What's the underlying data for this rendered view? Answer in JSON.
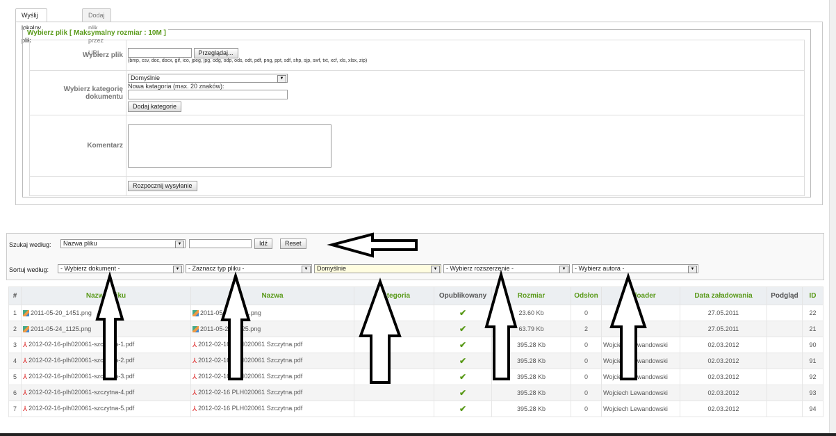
{
  "tabs": [
    "Wyślij lokalny plik",
    "Dodaj plik przez URL"
  ],
  "upload": {
    "legend": "Wybierz plik [ Maksymalny rozmiar : 10M ]",
    "file_label": "Wybierz plik",
    "browse": "Przeglądaj...",
    "extensions": "(bmp, csv, doc, docx, gif, ico, jpeg, jpg, odg, odp, ods, odt, pdf, png, ppt, sdf, shp, sjp, swf, txt, xcf, xls, xlsx, zip)",
    "category_label": "Wybierz kategorię dokumentu",
    "category_value": "Domyślnie",
    "new_category_label": "Nowa katagoria (max. 20 znaków):",
    "add_category": "Dodaj kategorie",
    "comment_label": "Komentarz",
    "start": "Rozpocznij wysyłanie"
  },
  "search": {
    "label": "Szukaj według:",
    "field": "Nazwa pliku",
    "go": "Idź",
    "reset": "Reset"
  },
  "sort": {
    "label": "Sortuj według:",
    "document": "- Wybierz dokument -",
    "type": "- Zaznacz typ pliku -",
    "category": "Domyślnie",
    "extension": "- Wybierz rozszerzenie -",
    "author": "- Wybierz autora -"
  },
  "columns": [
    "#",
    "Nazwa pliku",
    "Nazwa",
    "Kategoria",
    "Opublikowany",
    "Rozmiar",
    "Odsłon",
    "Uploader",
    "Data załadowania",
    "Podgląd",
    "ID"
  ],
  "rows": [
    {
      "n": "1",
      "file": "2011-05-20_1451.png",
      "name": "2011-05-20_1451.png",
      "type": "png",
      "size": "23.60 Kb",
      "views": "0",
      "uploader": "",
      "date": "27.05.2011",
      "id": "22"
    },
    {
      "n": "2",
      "file": "2011-05-24_1125.png",
      "name": "2011-05-24_1125.png",
      "type": "png",
      "size": "63.79 Kb",
      "views": "2",
      "uploader": "",
      "date": "27.05.2011",
      "id": "21"
    },
    {
      "n": "3",
      "file": "2012-02-16-plh020061-szczytna-1.pdf",
      "name": "2012-02-16 PLH020061 Szczytna.pdf",
      "type": "pdf",
      "size": "395.28 Kb",
      "views": "0",
      "uploader": "Wojciech Lewandowski",
      "date": "02.03.2012",
      "id": "90"
    },
    {
      "n": "4",
      "file": "2012-02-16-plh020061-szczytna-2.pdf",
      "name": "2012-02-16 PLH020061 Szczytna.pdf",
      "type": "pdf",
      "size": "395.28 Kb",
      "views": "0",
      "uploader": "Wojciech Lewandowski",
      "date": "02.03.2012",
      "id": "91"
    },
    {
      "n": "5",
      "file": "2012-02-16-plh020061-szczytna-3.pdf",
      "name": "2012-02-16 PLH020061 Szczytna.pdf",
      "type": "pdf",
      "size": "395.28 Kb",
      "views": "0",
      "uploader": "Wojciech Lewandowski",
      "date": "02.03.2012",
      "id": "92"
    },
    {
      "n": "6",
      "file": "2012-02-16-plh020061-szczytna-4.pdf",
      "name": "2012-02-16 PLH020061 Szczytna.pdf",
      "type": "pdf",
      "size": "395.28 Kb",
      "views": "0",
      "uploader": "Wojciech Lewandowski",
      "date": "02.03.2012",
      "id": "93"
    },
    {
      "n": "7",
      "file": "2012-02-16-plh020061-szczytna-5.pdf",
      "name": "2012-02-16 PLH020061 Szczytna.pdf",
      "type": "pdf",
      "size": "395.28 Kb",
      "views": "0",
      "uploader": "Wojciech Lewandowski",
      "date": "02.03.2012",
      "id": "94"
    }
  ],
  "colors": {
    "accent": "#5a9a1a",
    "highlight": "#fffde0"
  }
}
